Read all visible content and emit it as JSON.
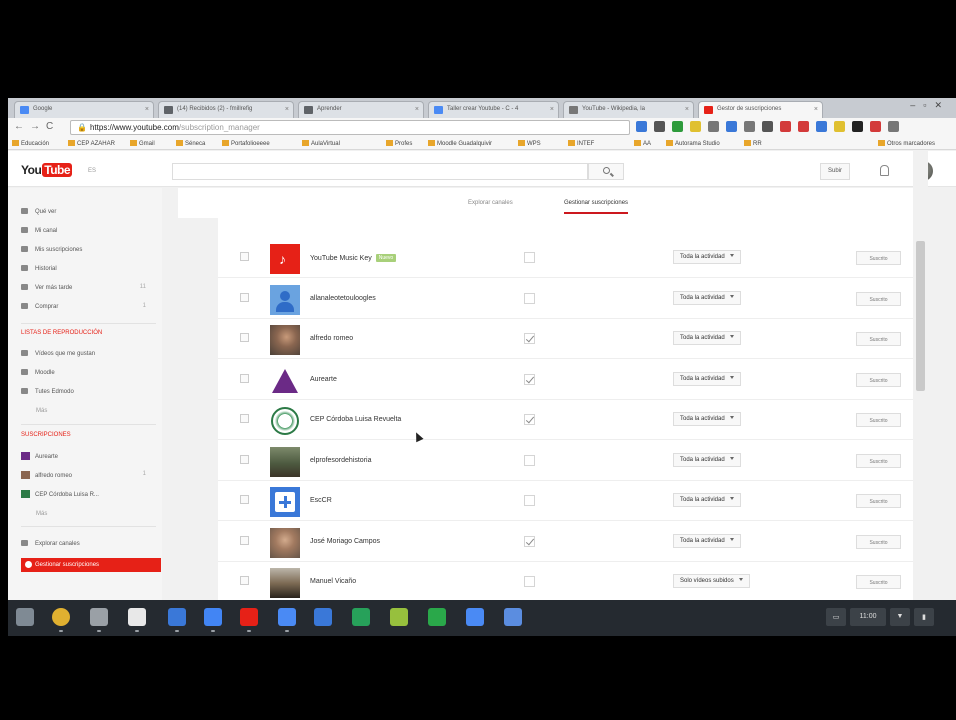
{
  "browser": {
    "tabs": [
      {
        "label": "Google",
        "favicon_color": "#4a8af4",
        "active": false
      },
      {
        "label": "(14) Recibidos (2) - fmillrefig",
        "favicon_color": "#5f6368",
        "active": false
      },
      {
        "label": "Aprender",
        "favicon_color": "#5f6368",
        "active": false
      },
      {
        "label": "Taller crear Youtube - C - 4",
        "favicon_color": "#4a8af4",
        "active": false
      },
      {
        "label": "YouTube - Wikipedia, la",
        "favicon_color": "#777777",
        "active": false
      },
      {
        "label": "Gestor de suscripciones",
        "favicon_color": "#e62117",
        "active": true
      }
    ],
    "url_host": "https://www.youtube.com",
    "url_path": "/subscription_manager",
    "bookmarks": [
      {
        "label": "Educación"
      },
      {
        "label": "CEP AZAHAR"
      },
      {
        "label": "Gmail"
      },
      {
        "label": "Séneca"
      },
      {
        "label": "Portafolioeeee"
      },
      {
        "label": "AulaVirtual"
      },
      {
        "label": "Profes"
      },
      {
        "label": "Moodle Guadalquivir"
      },
      {
        "label": "WPS"
      },
      {
        "label": "INTEF"
      },
      {
        "label": "AA"
      },
      {
        "label": "Autorama Studio"
      },
      {
        "label": "RR"
      },
      {
        "label": "Otros marcadores"
      }
    ],
    "extension_colors": [
      "#3a78d8",
      "#555555",
      "#2e9b3c",
      "#e0c030",
      "#777777",
      "#3a78d8",
      "#777777",
      "#555555",
      "#d33a3a",
      "#d33a3a",
      "#3a78d8",
      "#e0c030",
      "#222222",
      "#d33a3a",
      "#777777"
    ]
  },
  "youtube": {
    "logo_you": "You",
    "logo_tube": "Tube",
    "logo_country": "ES",
    "upload_label": "Subir",
    "guide": {
      "items": [
        {
          "label": "Qué ver",
          "icon": "home-icon"
        },
        {
          "label": "Mi canal",
          "icon": "channel-icon"
        },
        {
          "label": "Mis suscripciones",
          "icon": "subscriptions-icon"
        },
        {
          "label": "Historial",
          "icon": "history-icon"
        },
        {
          "label": "Ver más tarde",
          "icon": "watch-later-icon",
          "count": "11"
        },
        {
          "label": "Comprar",
          "icon": "purchases-icon",
          "count": "1"
        }
      ],
      "playlists_heading": "LISTAS DE REPRODUCCIÓN",
      "playlists": [
        {
          "label": "Vídeos que me gustan",
          "icon": "like-icon"
        },
        {
          "label": "Moodle",
          "icon": "playlist-icon"
        },
        {
          "label": "Tutes Edmodo",
          "icon": "playlist-icon"
        }
      ],
      "more_label": "Más",
      "subs_heading": "SUSCRIPCIONES",
      "subs": [
        {
          "label": "Aurearte",
          "color": "#6b2a86"
        },
        {
          "label": "alfredo romeo",
          "color": "#8a6650",
          "count": "1"
        },
        {
          "label": "CEP Córdoba Luisa R...",
          "color": "#2c7a46"
        }
      ],
      "subs_more_label": "Más",
      "explore_label": "Explorar canales",
      "manage_label": "Gestionar suscripciones"
    },
    "tabs": {
      "explore": "Explorar canales",
      "manage": "Gestionar suscripciones"
    },
    "subscriptions": [
      {
        "name": "YouTube Music Key",
        "badge": "Nuevo",
        "thumb": "music",
        "feed": false,
        "notif": "Toda la actividad",
        "unsub": "Suscrito"
      },
      {
        "name": "allanaleotetouloogles",
        "badge": "",
        "thumb": "default",
        "feed": false,
        "notif": "Toda la actividad",
        "unsub": "Suscrito"
      },
      {
        "name": "alfredo romeo",
        "badge": "",
        "thumb": "photo1",
        "feed": true,
        "notif": "Toda la actividad",
        "unsub": "Suscrito"
      },
      {
        "name": "Aurearte",
        "badge": "",
        "thumb": "triangle",
        "feed": true,
        "notif": "Toda la actividad",
        "unsub": "Suscrito"
      },
      {
        "name": "CEP Córdoba Luisa Revuelta",
        "badge": "",
        "thumb": "seal",
        "feed": true,
        "notif": "Toda la actividad",
        "unsub": "Suscrito"
      },
      {
        "name": "elprofesordehistoria",
        "badge": "",
        "thumb": "landscape",
        "feed": false,
        "notif": "Toda la actividad",
        "unsub": "Suscrito"
      },
      {
        "name": "EscCR",
        "badge": "",
        "thumb": "plus",
        "feed": false,
        "notif": "Toda la actividad",
        "unsub": "Suscrito"
      },
      {
        "name": "José Moriago Campos",
        "badge": "",
        "thumb": "photo2",
        "feed": true,
        "notif": "Toda la actividad",
        "unsub": "Suscrito"
      },
      {
        "name": "Manuel Vicaño",
        "badge": "",
        "thumb": "photo3",
        "feed": false,
        "notif": "Solo vídeos subidos",
        "unsub": "Suscrito"
      }
    ]
  },
  "taskbar": {
    "apps": [
      {
        "name": "launcher-icon",
        "color": "#7f8a94"
      },
      {
        "name": "chrome-icon",
        "color": "#e0b030"
      },
      {
        "name": "mail-icon",
        "color": "#9aa0a6"
      },
      {
        "name": "headphones-icon",
        "color": "#e8e8e8"
      },
      {
        "name": "docs-icon",
        "color": "#3a78d8"
      },
      {
        "name": "files-icon",
        "color": "#4285f4"
      },
      {
        "name": "youtube-icon",
        "color": "#e62117"
      },
      {
        "name": "shield-icon",
        "color": "#4a8af4"
      },
      {
        "name": "box-icon",
        "color": "#3a78d8"
      },
      {
        "name": "drive-icon",
        "color": "#27a15a"
      },
      {
        "name": "android-icon",
        "color": "#97c03d"
      },
      {
        "name": "tree-icon",
        "color": "#2aa84a"
      },
      {
        "name": "photos-icon",
        "color": "#4a8af4"
      },
      {
        "name": "calendar-icon",
        "color": "#5b8de0"
      }
    ],
    "clock": "11:00"
  }
}
